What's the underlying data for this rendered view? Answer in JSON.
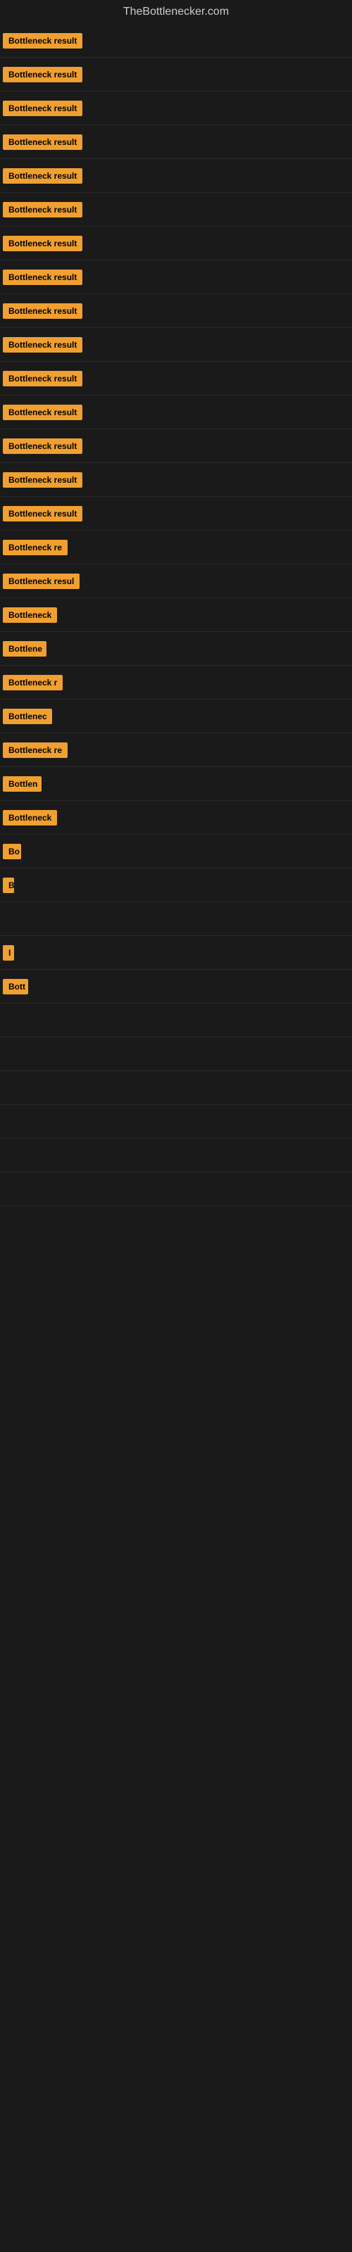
{
  "site": {
    "title": "TheBottlenecker.com"
  },
  "rows": [
    {
      "id": 1,
      "badge": "Bottleneck result",
      "width": 130
    },
    {
      "id": 2,
      "badge": "Bottleneck result",
      "width": 130
    },
    {
      "id": 3,
      "badge": "Bottleneck result",
      "width": 130
    },
    {
      "id": 4,
      "badge": "Bottleneck result",
      "width": 130
    },
    {
      "id": 5,
      "badge": "Bottleneck result",
      "width": 130
    },
    {
      "id": 6,
      "badge": "Bottleneck result",
      "width": 130
    },
    {
      "id": 7,
      "badge": "Bottleneck result",
      "width": 130
    },
    {
      "id": 8,
      "badge": "Bottleneck result",
      "width": 130
    },
    {
      "id": 9,
      "badge": "Bottleneck result",
      "width": 130
    },
    {
      "id": 10,
      "badge": "Bottleneck result",
      "width": 130
    },
    {
      "id": 11,
      "badge": "Bottleneck result",
      "width": 130
    },
    {
      "id": 12,
      "badge": "Bottleneck result",
      "width": 130
    },
    {
      "id": 13,
      "badge": "Bottleneck result",
      "width": 130
    },
    {
      "id": 14,
      "badge": "Bottleneck result",
      "width": 130
    },
    {
      "id": 15,
      "badge": "Bottleneck result",
      "width": 130
    },
    {
      "id": 16,
      "badge": "Bottleneck re",
      "width": 100
    },
    {
      "id": 17,
      "badge": "Bottleneck resul",
      "width": 110
    },
    {
      "id": 18,
      "badge": "Bottleneck",
      "width": 80
    },
    {
      "id": 19,
      "badge": "Bottlene",
      "width": 62
    },
    {
      "id": 20,
      "badge": "Bottleneck r",
      "width": 88
    },
    {
      "id": 21,
      "badge": "Bottlenec",
      "width": 70
    },
    {
      "id": 22,
      "badge": "Bottleneck re",
      "width": 100
    },
    {
      "id": 23,
      "badge": "Bottlen",
      "width": 55
    },
    {
      "id": 24,
      "badge": "Bottleneck",
      "width": 80
    },
    {
      "id": 25,
      "badge": "Bo",
      "width": 26
    },
    {
      "id": 26,
      "badge": "B",
      "width": 16
    },
    {
      "id": 27,
      "badge": "",
      "width": 0
    },
    {
      "id": 28,
      "badge": "I",
      "width": 10
    },
    {
      "id": 29,
      "badge": "Bott",
      "width": 36
    },
    {
      "id": 30,
      "badge": "",
      "width": 0
    },
    {
      "id": 31,
      "badge": "",
      "width": 0
    },
    {
      "id": 32,
      "badge": "",
      "width": 0
    },
    {
      "id": 33,
      "badge": "",
      "width": 0
    },
    {
      "id": 34,
      "badge": "",
      "width": 0
    },
    {
      "id": 35,
      "badge": "",
      "width": 0
    }
  ]
}
